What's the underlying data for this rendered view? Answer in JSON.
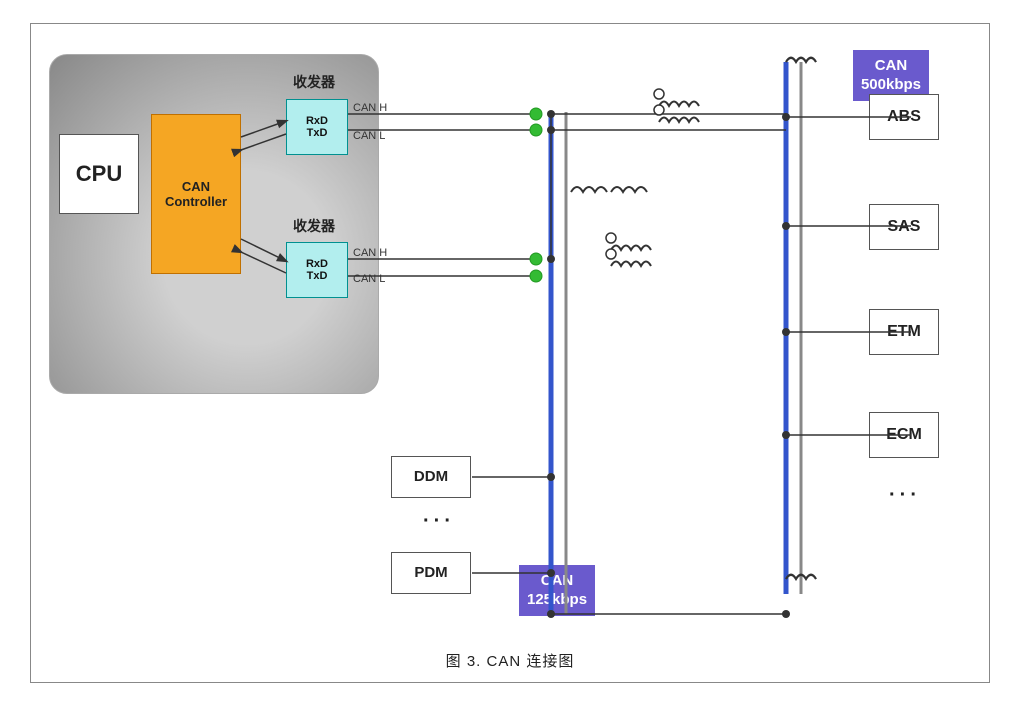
{
  "diagram": {
    "caption": "图 3.    CAN 连接图",
    "cpu_label": "CPU",
    "can_controller_label": "CAN\nController",
    "transceiver1_label": "收发器",
    "transceiver2_label": "收发器",
    "transceiver1_lines": [
      "RxD",
      "TxD"
    ],
    "transceiver2_lines": [
      "RxD",
      "TxD"
    ],
    "canh1": "CAN H",
    "canl1": "CAN L",
    "canh2": "CAN H",
    "canl2": "CAN L",
    "can_badge1": "CAN\n500kbps",
    "can_badge2": "CAN\n125kbps",
    "nodes_right": [
      "ABS",
      "SAS",
      "ETM",
      "ECM"
    ],
    "nodes_bottom": [
      "DDM",
      "PDM"
    ],
    "dots": "···"
  }
}
